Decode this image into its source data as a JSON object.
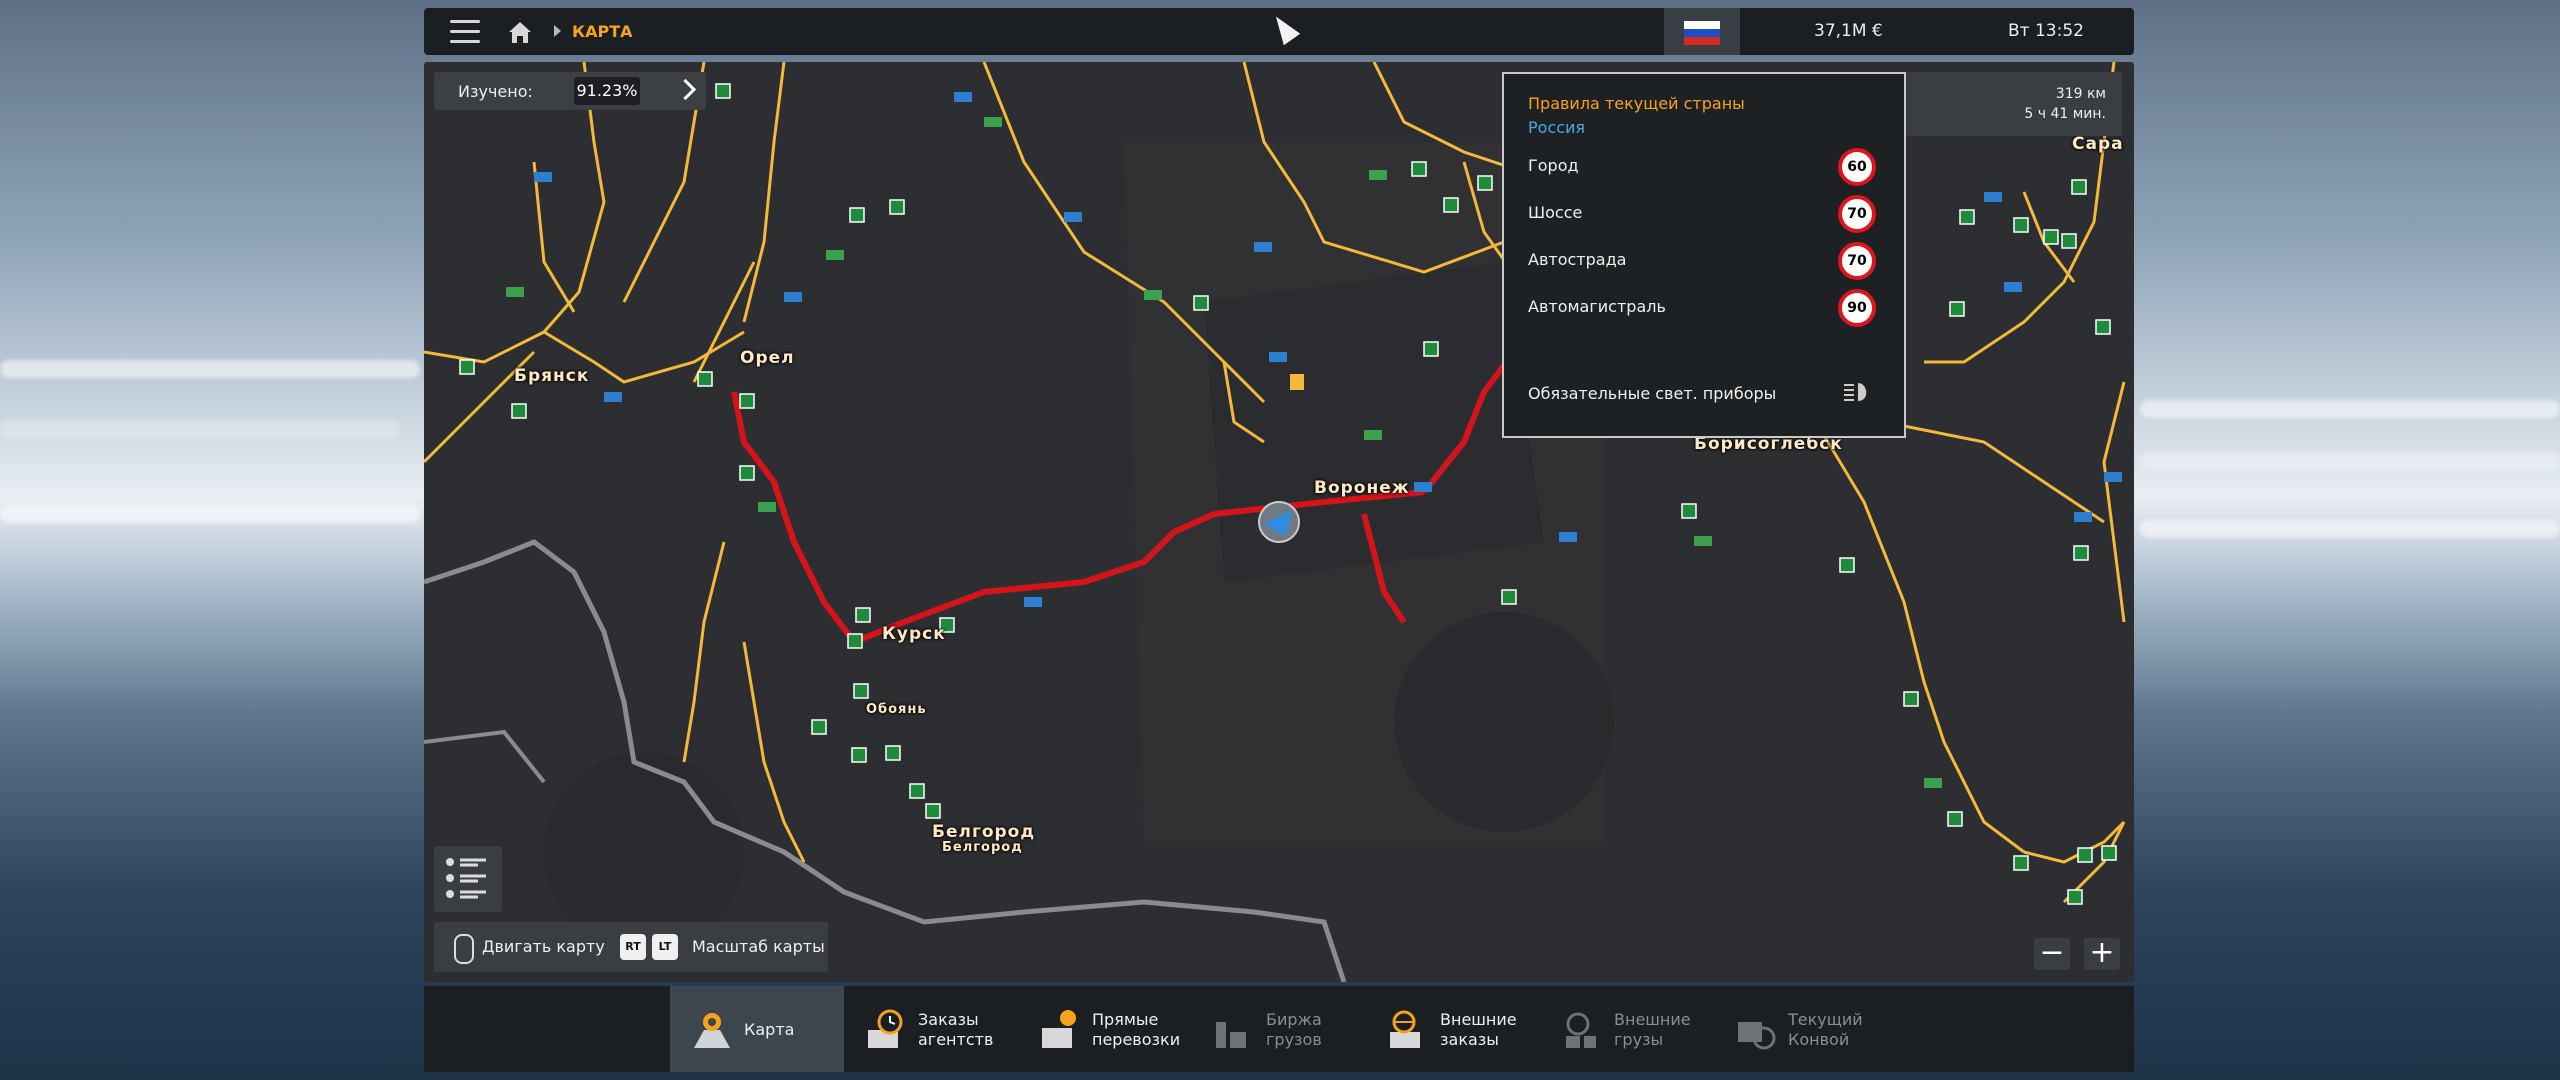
{
  "topbar": {
    "breadcrumb": "КАРТА",
    "money": "37,1M  €",
    "clock": "Вт 13:52"
  },
  "map": {
    "explored_label": "Изучено:",
    "explored_value": "91.23%",
    "cities": {
      "bryansk": "Брянск",
      "orel": "Орел",
      "kursk": "Курск",
      "oboyan": "Обоянь",
      "belgorod": "Белгород",
      "belgorod_small": "Белгород",
      "voronezh": "Воронеж",
      "borisoglebsk": "Борисоглебск",
      "sara": "Сара"
    }
  },
  "country_rules": {
    "title": "Правила текущей страны",
    "country": "Россия",
    "rows": [
      {
        "label": "Город",
        "limit": "60"
      },
      {
        "label": "Шоссе",
        "limit": "70"
      },
      {
        "label": "Автострада",
        "limit": "70"
      },
      {
        "label": "Автомагистраль",
        "limit": "90"
      }
    ],
    "lights_label": "Обязательные свет. приборы"
  },
  "route_info": {
    "distance": "319 км",
    "time": "5 ч 41 мин."
  },
  "hints": {
    "move_map": "Двигать карту",
    "key_rt": "RT",
    "key_lt": "LT",
    "zoom_map": "Масштаб карты"
  },
  "tabs": [
    {
      "label": "Карта",
      "active": true
    },
    {
      "label": "Заказы\nагентств"
    },
    {
      "label": "Прямые\nперевозки"
    },
    {
      "label": "Биржа\nгрузов",
      "dim": true
    },
    {
      "label": "Внешние\nзаказы"
    },
    {
      "label": "Внешние\nгрузы",
      "dim": true
    },
    {
      "label": "Текущий\nКонвой",
      "dim": true
    }
  ],
  "colors": {
    "accent": "#f7a21b",
    "route": "#d4141a",
    "road": "#f4b83a",
    "country": "#47a9e8"
  }
}
